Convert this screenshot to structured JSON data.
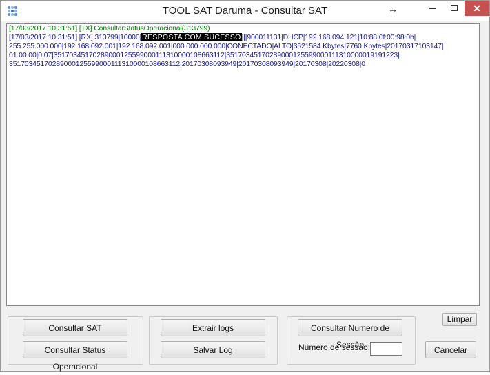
{
  "window": {
    "title": "TOOL SAT Daruma - Consultar SAT"
  },
  "log": {
    "tx_line": "[17/03/2017 10:31:51] [TX] ConsultarStatusOperacional(313799)",
    "rx_prefix": "[17/03/2017 10:31:51] [RX] 313799|10000|",
    "rx_highlight": "RESPOSTA COM SUCESSO",
    "rx_suffix": "|||900011131|DHCP|192.168.094.121|10:88:0f:00:98:0b|",
    "lines": [
      "255.255.000.000|192.168.092.001|192.168.092.001|000.000.000.000|CONECTADO|ALTO|3521584 Kbytes|7760 Kbytes|20170317103147|",
      "01.00.00|0.07|35170345170289000125599000111310000108663112|35170345170289000125599000111310000019191223|",
      "35170345170289000125599000111310000108663112|20170308093949|20170308093949|20170308|20220308|0"
    ]
  },
  "buttons": {
    "consultar_sat": "Consultar SAT",
    "consultar_status": "Consultar Status Operacional",
    "extrair_logs": "Extrair logs",
    "salvar_log": "Salvar Log",
    "consultar_numero": "Consultar Numero de Sessão",
    "limpar": "Limpar",
    "cancelar": "Cancelar"
  },
  "session": {
    "label": "Número de sessão:",
    "value": ""
  }
}
